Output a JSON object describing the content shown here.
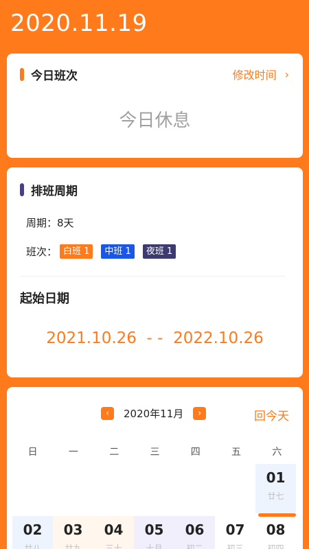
{
  "header": {
    "date": "2020.11.19"
  },
  "today_card": {
    "title": "今日班次",
    "edit_label": "修改时间",
    "chevron_icon": "chevron-right-icon",
    "status": "今日休息"
  },
  "cycle_card": {
    "title": "排班周期",
    "period_label": "周期：",
    "period_value": "8天",
    "shifts_label": "班次：",
    "shifts": [
      {
        "label": "白班 1",
        "color": "#FF7A1A"
      },
      {
        "label": "中班 1",
        "color": "#1A56E8"
      },
      {
        "label": "夜班 1",
        "color": "#3C3A6E"
      }
    ],
    "start_title": "起始日期",
    "range": "2021.10.26  - -  2022.10.26"
  },
  "calendar": {
    "prev_icon": "chevron-left-icon",
    "next_icon": "chevron-right-icon",
    "month": "2020年11月",
    "today_label": "回今天",
    "weekdays": [
      "日",
      "一",
      "二",
      "三",
      "四",
      "五",
      "六"
    ],
    "days": [
      {
        "num": "01",
        "lunar": "廿七"
      },
      {
        "num": "02",
        "lunar": "廿八"
      },
      {
        "num": "03",
        "lunar": "廿九"
      },
      {
        "num": "04",
        "lunar": "三十"
      },
      {
        "num": "05",
        "lunar": "十月"
      },
      {
        "num": "06",
        "lunar": "初二"
      },
      {
        "num": "07",
        "lunar": "初三"
      },
      {
        "num": "08",
        "lunar": "初四"
      }
    ]
  },
  "colors": {
    "accent": "#FF7A1A",
    "purple": "#4A3D8F",
    "blue": "#1A56E8",
    "navy": "#3C3A6E"
  }
}
